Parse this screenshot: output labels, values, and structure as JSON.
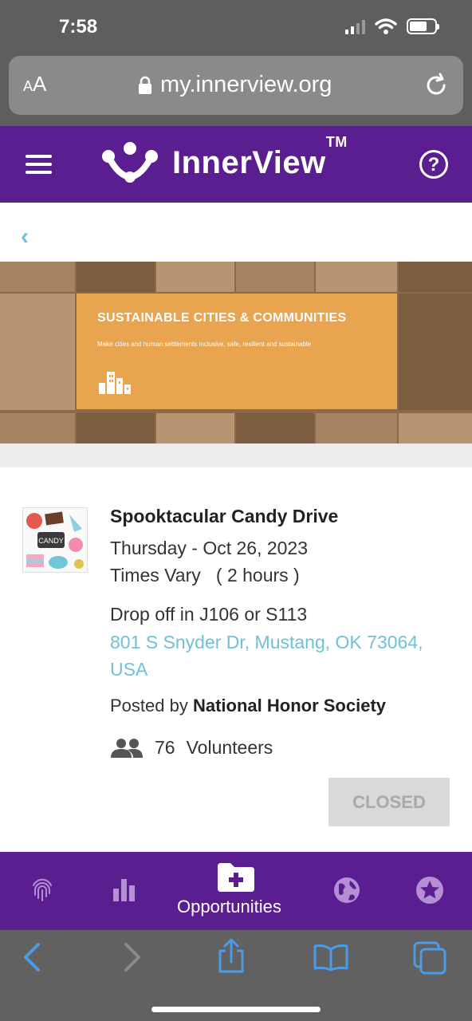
{
  "status_bar": {
    "time": "7:58"
  },
  "browser": {
    "text_size_label": "AA",
    "url": "my.innerview.org"
  },
  "app": {
    "brand": "InnerView",
    "trademark": "TM",
    "header_color": "#5b1e91",
    "accent_link_color": "#6fc1d8"
  },
  "banner": {
    "title": "SUSTAINABLE CITIES & COMMUNITIES",
    "subtitle": "Make cities and human settlements inclusive, safe, resilient and sustainable"
  },
  "opportunity": {
    "title": "Spooktacular Candy Drive",
    "thumb_label": "CANDY",
    "date": "Thursday - Oct 26, 2023",
    "times": "Times Vary",
    "duration": "( 2 hours )",
    "location": "Drop off in J106 or S113",
    "address": "801 S Snyder Dr, Mustang, OK 73064, USA",
    "posted_by_prefix": "Posted by",
    "posted_by": "National Honor Society",
    "volunteer_count": "76",
    "volunteer_label": "Volunteers",
    "status_button": "CLOSED"
  },
  "bottom_nav": {
    "items": [
      {
        "icon": "fingerprint-icon"
      },
      {
        "icon": "bar-chart-icon"
      },
      {
        "icon": "folder-plus-icon",
        "label": "Opportunities",
        "active": true
      },
      {
        "icon": "globe-icon"
      },
      {
        "icon": "star-badge-icon"
      }
    ]
  }
}
